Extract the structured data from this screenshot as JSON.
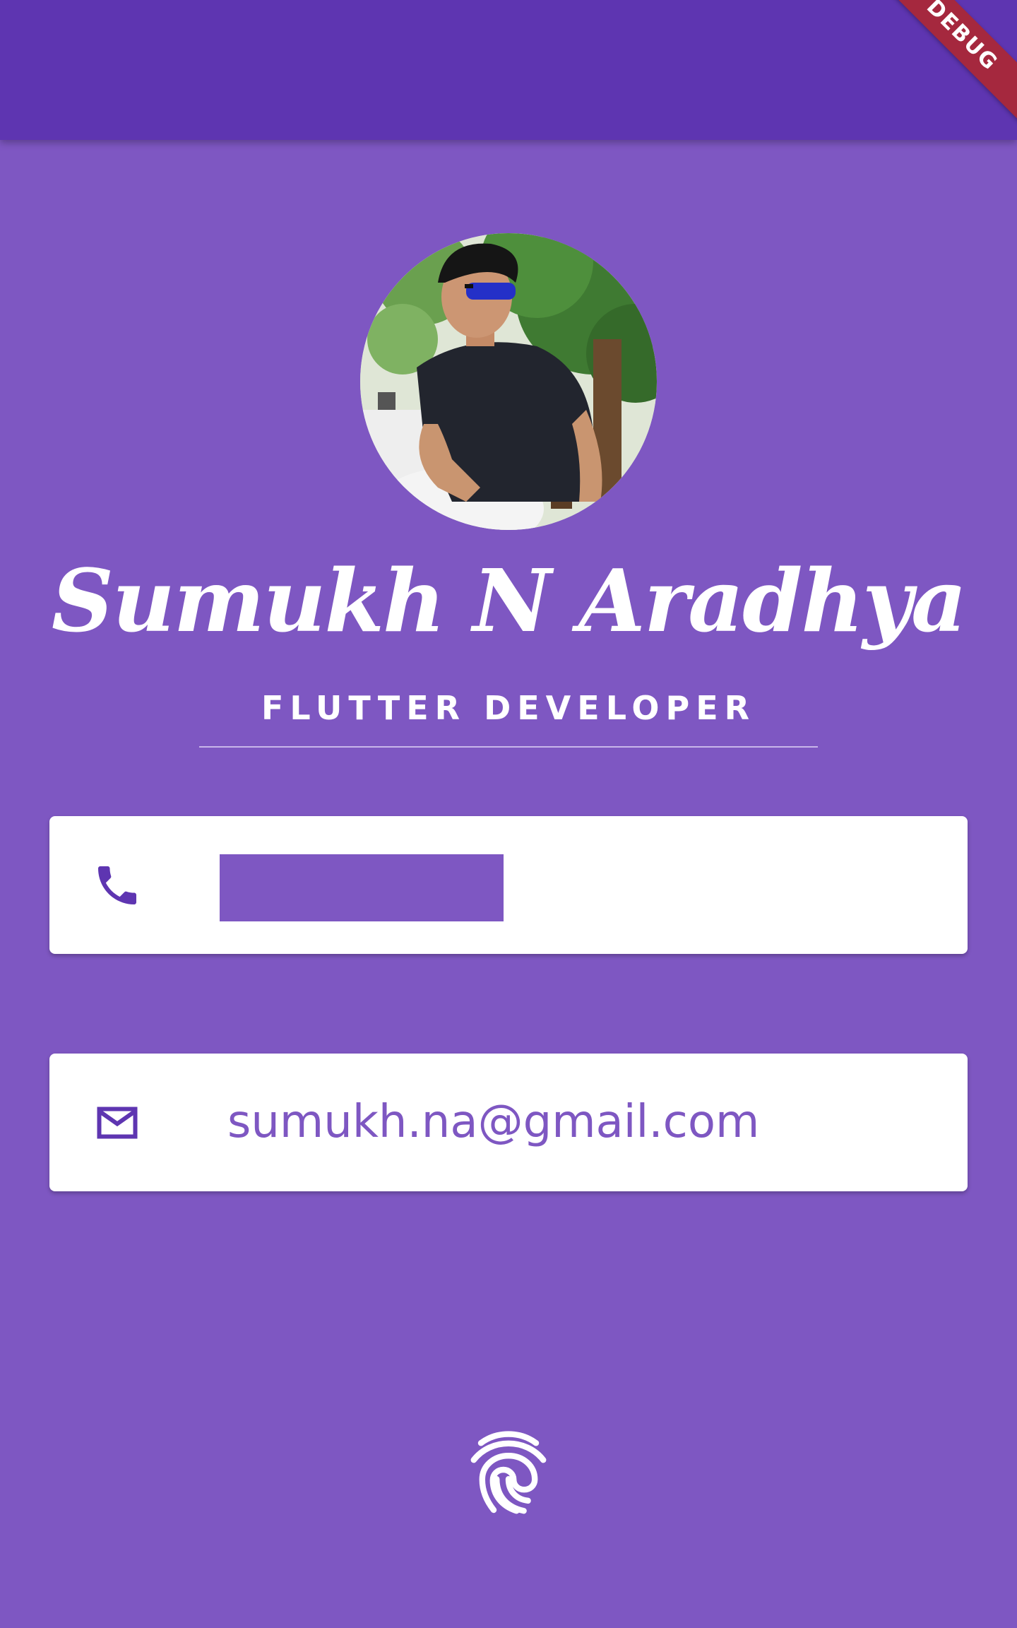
{
  "debug_banner": {
    "label": "DEBUG"
  },
  "profile": {
    "name": "Sumukh N Aradhya",
    "role": "FLUTTER DEVELOPER"
  },
  "contacts": {
    "phone": {
      "icon": "phone-icon",
      "value": ""
    },
    "email": {
      "icon": "mail-icon",
      "value": "sumukh.na@gmail.com"
    }
  },
  "footer": {
    "icon": "fingerprint-icon"
  },
  "colors": {
    "app_bar": "#5e35b1",
    "background": "#7e57c2",
    "card": "#ffffff",
    "accent": "#7e57c2",
    "debug_ribbon": "#a5283e"
  }
}
